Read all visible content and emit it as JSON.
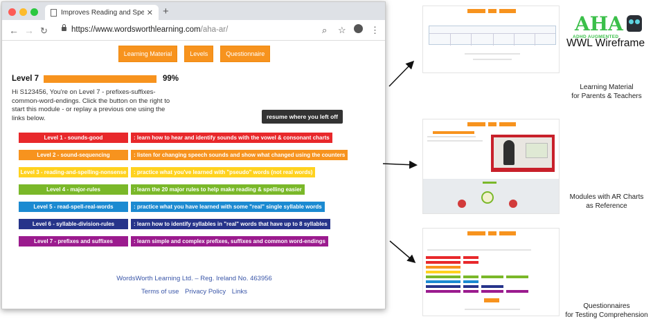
{
  "browser": {
    "tab_title": "Improves Reading and Spellin",
    "url_host": "https://www.wordsworthlearning.com",
    "url_path": "/aha-ar/"
  },
  "nav": {
    "learning_material": "Learning Material",
    "levels": "Levels",
    "questionnaire": "Questionnaire"
  },
  "progress": {
    "level_label": "Level 7",
    "percent_text": "99%",
    "percent_value": 0.99
  },
  "intro_text": "Hi S123456, You're on Level 7 - prefixes-suffixes-common-word-endings. Click the button on the right to start this module - or replay a previous one using the links below.",
  "resume_label": "resume where you left off",
  "levels": [
    {
      "name": "Level 1 - sounds-good",
      "desc": ": learn how to hear and identify sounds with the vowel & consonant charts",
      "color": "#e8282b"
    },
    {
      "name": "Level 2 - sound-sequencing",
      "desc": ": listen for changing speech sounds and show what changed using the counters",
      "color": "#f7931e"
    },
    {
      "name": "Level 3 - reading-and-spelling-nonsense",
      "desc": ": practice what you've learned with \"pseudo\" words (not real words)",
      "color": "#ffd21f"
    },
    {
      "name": "Level 4 - major-rules",
      "desc": ": learn the 20 major rules to help make reading & spelling easier",
      "color": "#7ab829"
    },
    {
      "name": "Level 5 - read-spell-real-words",
      "desc": ": practice what you have learned with some \"real\" single syllable words",
      "color": "#1b8ad1"
    },
    {
      "name": "Level 6 - syllable-division-rules",
      "desc": ": learn how to identify syllables in \"real\" words that have up to 8 syllables",
      "color": "#26348a"
    },
    {
      "name": "Level 7 - prefixes and suffixes",
      "desc": ": learn simple and complex prefixes, suffixes and common word-endings",
      "color": "#9b1b8e"
    }
  ],
  "footer": {
    "company": "WordsWorth Learning Ltd. – Reg. Ireland No. 463956",
    "terms": "Terms of use",
    "privacy": "Privacy Policy",
    "links": "Links"
  },
  "logo": {
    "title": "AHA",
    "subtitle": "ADHD AUGMENTED"
  },
  "wwl_title": "WWL Wireframe",
  "captions": {
    "learning": [
      "Learning Material",
      "for Parents & Teachers"
    ],
    "modules": [
      "Modules with AR Charts",
      "as Reference"
    ],
    "questionnaires": [
      "Questionnaires",
      "for Testing Comprehension"
    ]
  },
  "colors": {
    "accent_orange": "#f7931e",
    "footer_link": "#3a56a8",
    "logo_green": "#3bbf4a"
  },
  "icons": [
    "back-arrow-icon",
    "forward-arrow-icon",
    "reload-icon",
    "lock-icon",
    "search-icon",
    "star-icon",
    "account-icon",
    "menu-icon",
    "document-icon",
    "close-icon",
    "new-tab-icon"
  ]
}
